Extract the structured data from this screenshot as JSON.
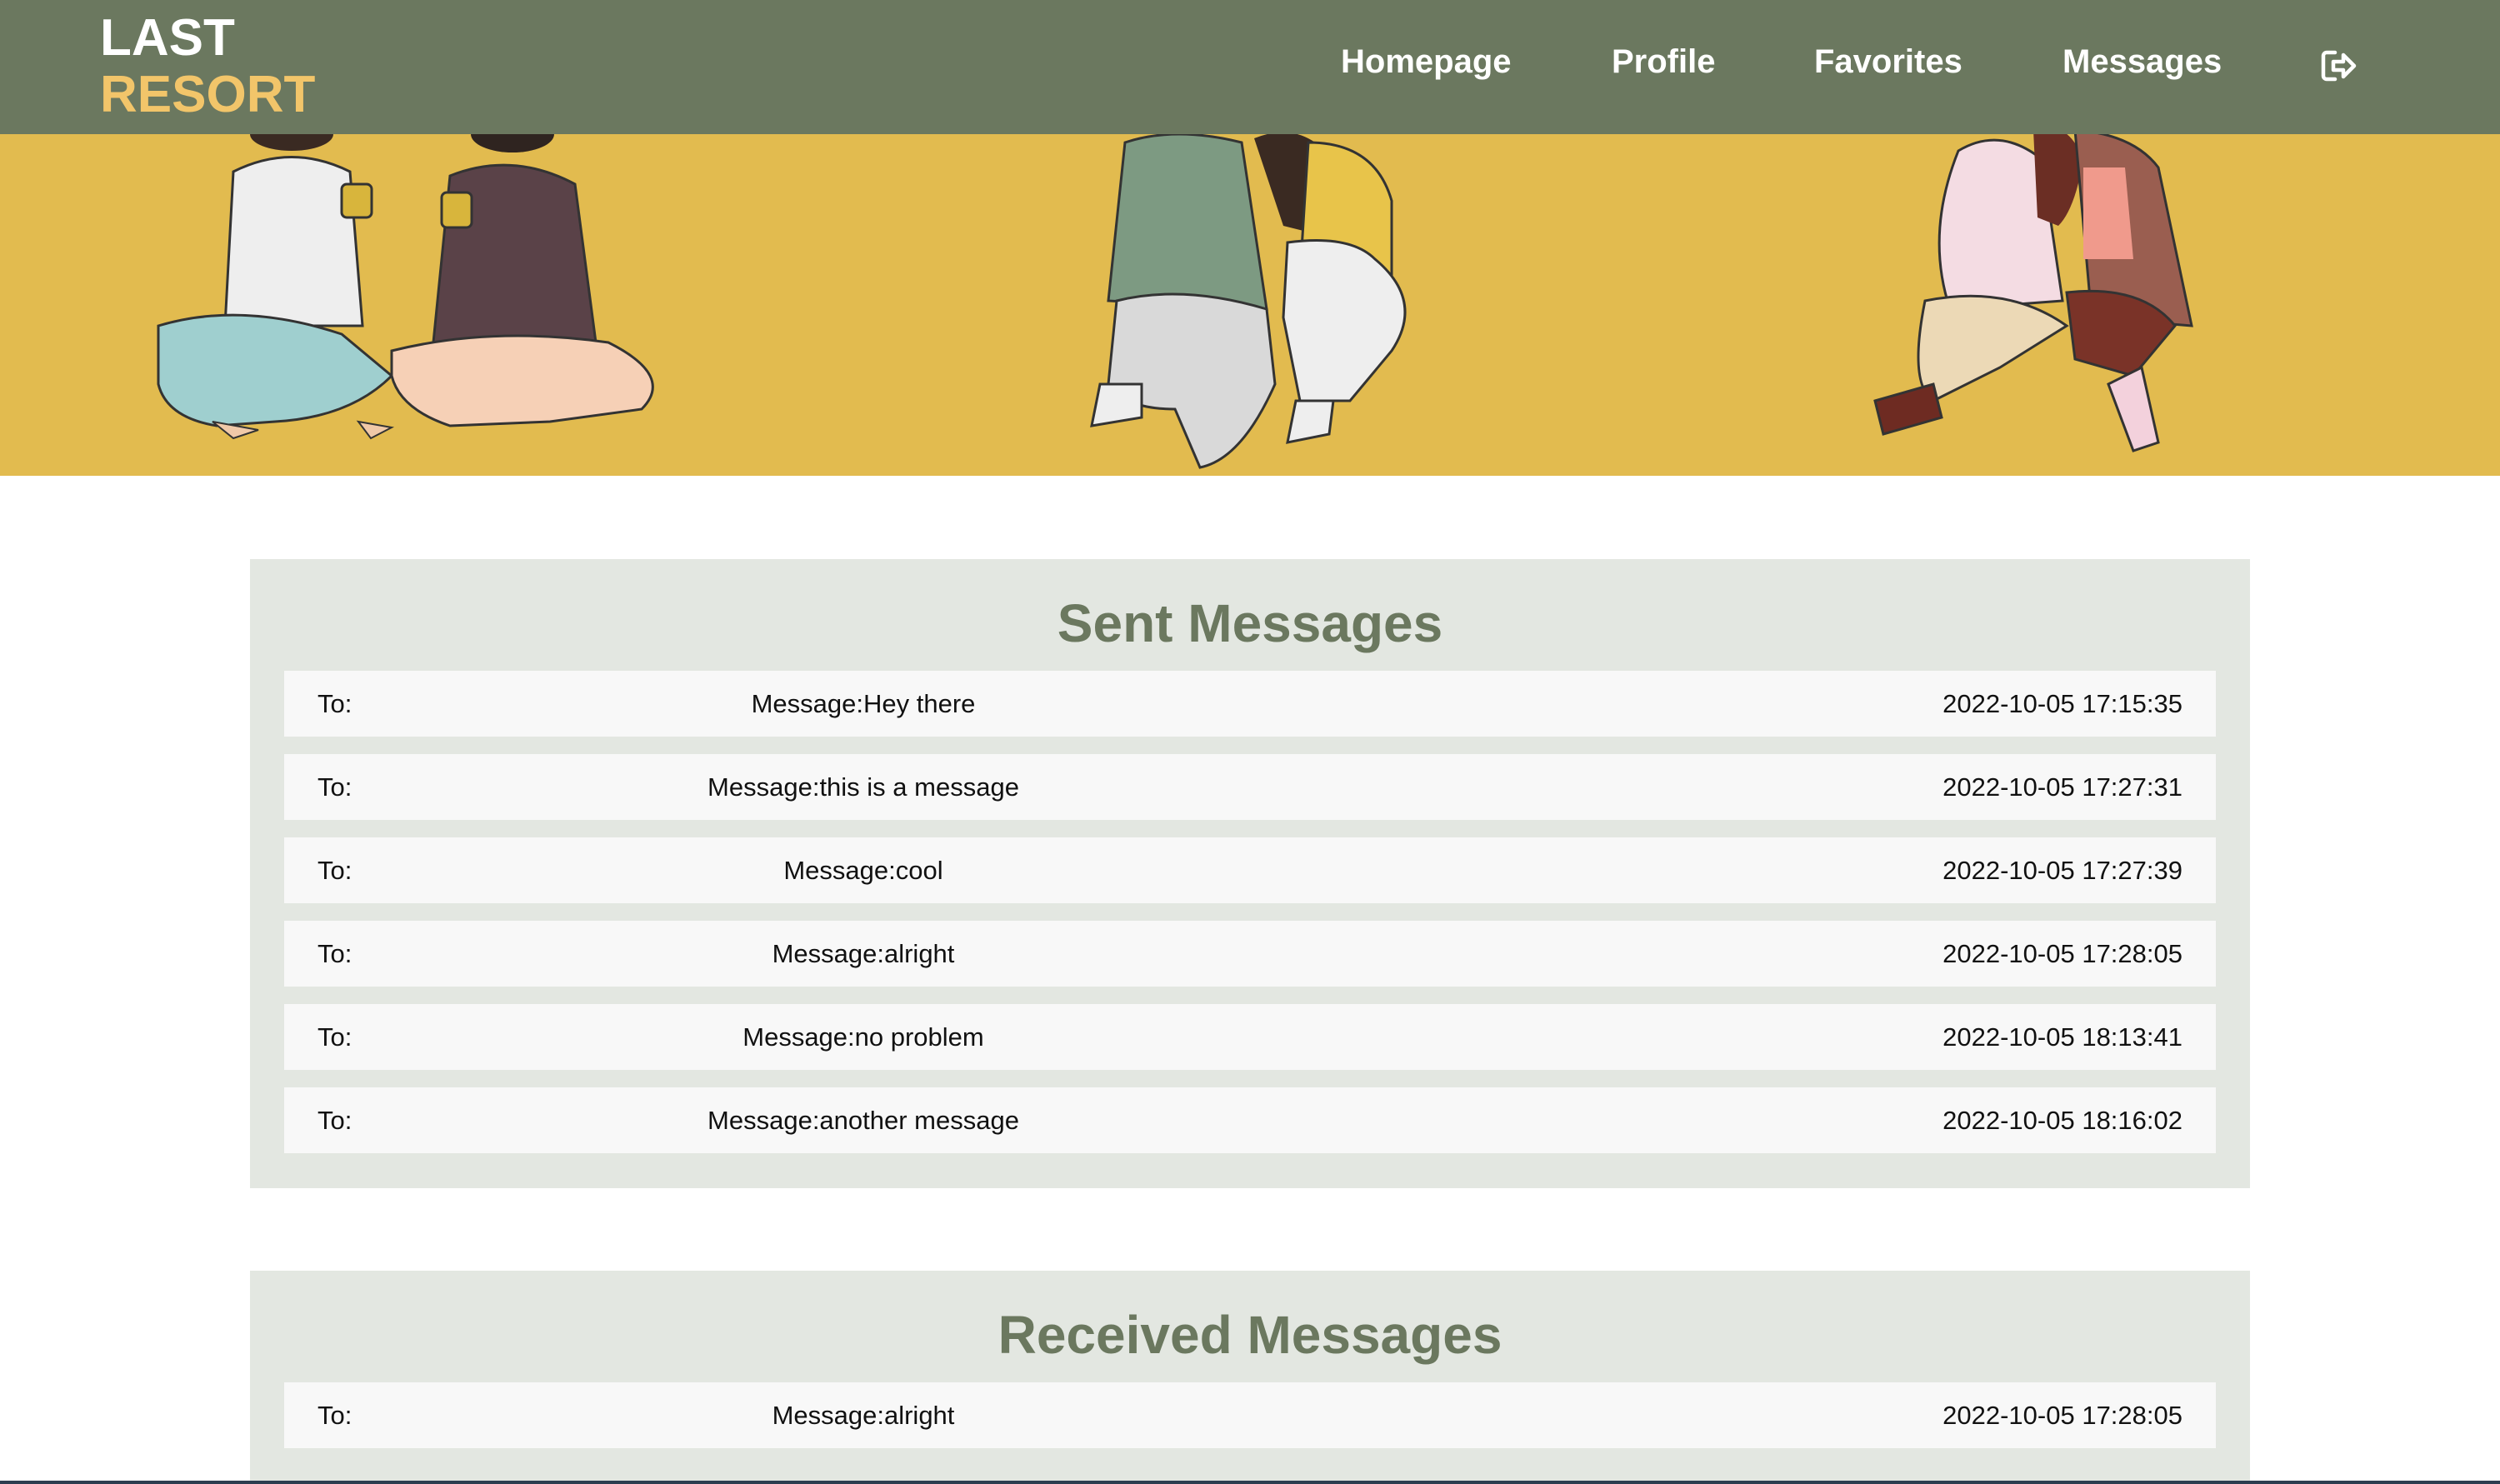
{
  "header": {
    "logo_line1": "LAST",
    "logo_line2": "RESORT",
    "nav": [
      "Homepage",
      "Profile",
      "Favorites",
      "Messages"
    ],
    "logout_icon": "logout-icon"
  },
  "colors": {
    "nav_bg": "#6b785f",
    "logo_accent": "#f2c56a",
    "banner_bg": "#e2bb4f",
    "panel_bg": "#e3e7e1",
    "row_bg": "#f8f8f8",
    "title_color": "#6b785f"
  },
  "sent": {
    "title": "Sent Messages",
    "rows": [
      {
        "to": "To:",
        "message": "Message:Hey there",
        "time": "2022-10-05 17:15:35"
      },
      {
        "to": "To:",
        "message": "Message:this is a message",
        "time": "2022-10-05 17:27:31"
      },
      {
        "to": "To:",
        "message": "Message:cool",
        "time": "2022-10-05 17:27:39"
      },
      {
        "to": "To:",
        "message": "Message:alright",
        "time": "2022-10-05 17:28:05"
      },
      {
        "to": "To:",
        "message": "Message:no problem",
        "time": "2022-10-05 18:13:41"
      },
      {
        "to": "To:",
        "message": "Message:another message",
        "time": "2022-10-05 18:16:02"
      }
    ]
  },
  "received": {
    "title": "Received Messages",
    "rows": [
      {
        "to": "To:",
        "message": "Message:alright",
        "time": "2022-10-05 17:28:05"
      }
    ]
  }
}
